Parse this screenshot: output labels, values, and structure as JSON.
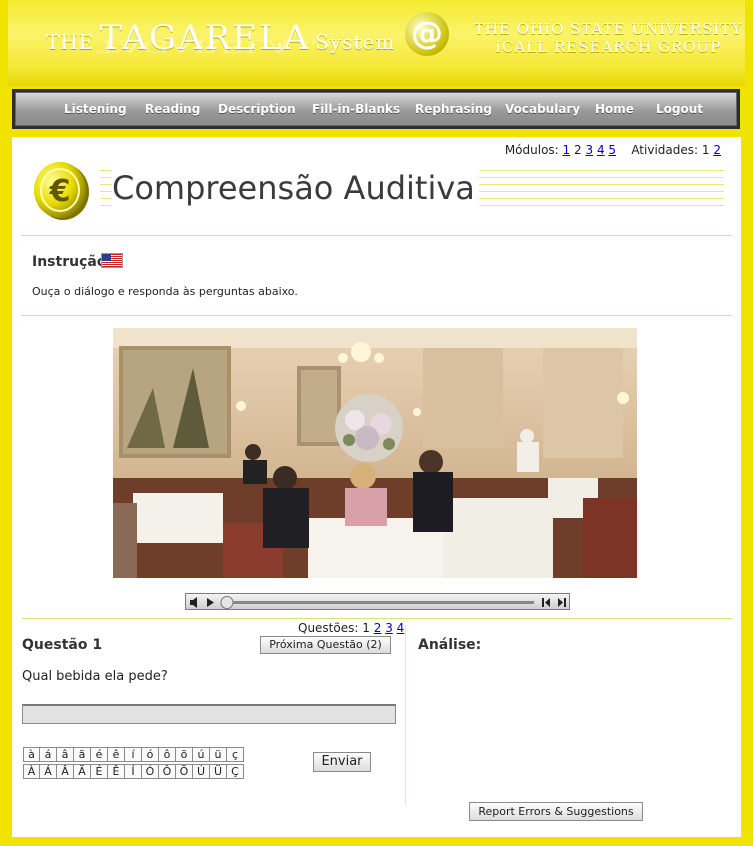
{
  "header": {
    "logo_the": "THE",
    "logo_name": "TAGARELA",
    "logo_system": "System",
    "at_symbol": "@",
    "university_line1": "THE OHIO STATE UNIVERSITY",
    "university_line2": "ICALL RESEARCH GROUP"
  },
  "nav": {
    "items": [
      {
        "label": "Listening"
      },
      {
        "label": "Reading"
      },
      {
        "label": "Description"
      },
      {
        "label": "Fill-in-Blanks"
      },
      {
        "label": "Rephrasing"
      },
      {
        "label": "Vocabulary"
      },
      {
        "label": "Home"
      },
      {
        "label": "Logout"
      }
    ]
  },
  "modules": {
    "label": "Módulos:",
    "items": [
      "1",
      "2",
      "3",
      "4",
      "5"
    ],
    "current": "2",
    "activities_label": "Atividades:",
    "activities": [
      "1",
      "2"
    ],
    "current_activity": "1"
  },
  "page": {
    "title": "Compreensão Auditiva",
    "instruction_title": "Instrução",
    "instruction_text": "Ouça o diálogo e responda às perguntas abaixo."
  },
  "questions": {
    "label": "Questões:",
    "items": [
      "1",
      "2",
      "3",
      "4"
    ],
    "current": "1",
    "title": "Questão 1",
    "next_button": "Próxima Questão (2)",
    "prompt": "Qual bebida ela pede?",
    "answer_value": ""
  },
  "analysis": {
    "title": "Análise:"
  },
  "keyboard": {
    "lower": [
      "à",
      "á",
      "â",
      "ã",
      "é",
      "ê",
      "í",
      "ó",
      "ô",
      "õ",
      "ú",
      "ü",
      "ç"
    ],
    "upper": [
      "À",
      "Á",
      "Â",
      "Ã",
      "É",
      "Ê",
      "Í",
      "Ó",
      "Ô",
      "Õ",
      "Ú",
      "Ü",
      "Ç"
    ]
  },
  "buttons": {
    "send": "Enviar",
    "report": "Report Errors & Suggestions"
  },
  "colors": {
    "brand_yellow": "#f0e300",
    "link_blue": "#0000cc",
    "nav_bar": "#9a9a9a"
  }
}
